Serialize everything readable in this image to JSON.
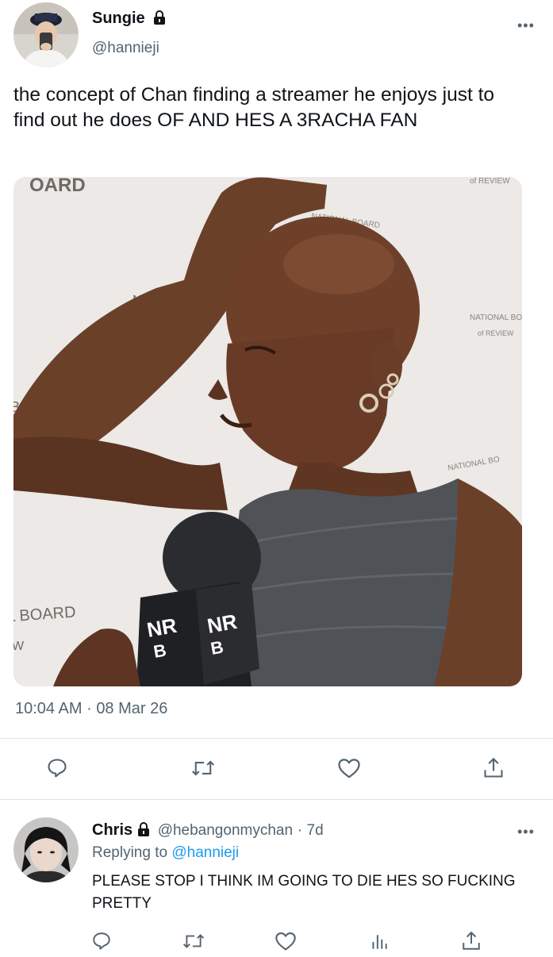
{
  "main_tweet": {
    "author_name": "Sungie",
    "author_handle": "@hannieji",
    "text": "the concept of Chan finding a streamer he enjoys just to find out he does OF AND HES A 3RACHA FAN",
    "timestamp": "10:04 AM",
    "separator": "·",
    "date": "08 Mar 26",
    "more_label": "•••"
  },
  "media_text": {
    "backdrop_top": "OARD",
    "backdrop_top_right": "of REVIEW",
    "backdrop_national": "NATIONAL BOARD",
    "backdrop_right": "NATIONAL BO",
    "backdrop_right_sub": "of REVIEW",
    "backdrop_right2": "NATIONAL BO",
    "backdrop_bottom_left": "L BOARD",
    "backdrop_w": "W",
    "backdrop_bo": "BO",
    "backdrop_na": "NA",
    "mic_1a": "NR",
    "mic_1b": "B",
    "mic_2a": "NR",
    "mic_2b": "B"
  },
  "reply": {
    "author_name": "Chris",
    "author_handle": "@hebangonmychan",
    "separator": "·",
    "age": "7d",
    "replying_prefix": "Replying to",
    "replying_to": "@hannieji",
    "text": "PLEASE STOP I THINK IM GOING TO DIE HES SO FUCKING PRETTY",
    "more_label": "•••"
  },
  "icons": {
    "reply": "reply-icon",
    "retweet": "retweet-icon",
    "like": "like-icon",
    "share": "share-icon",
    "analytics": "analytics-icon",
    "lock": "lock-icon"
  },
  "colors": {
    "text": "#0f1419",
    "secondary": "#536471",
    "link": "#1d9bf0",
    "divider": "#e1e4e8"
  }
}
